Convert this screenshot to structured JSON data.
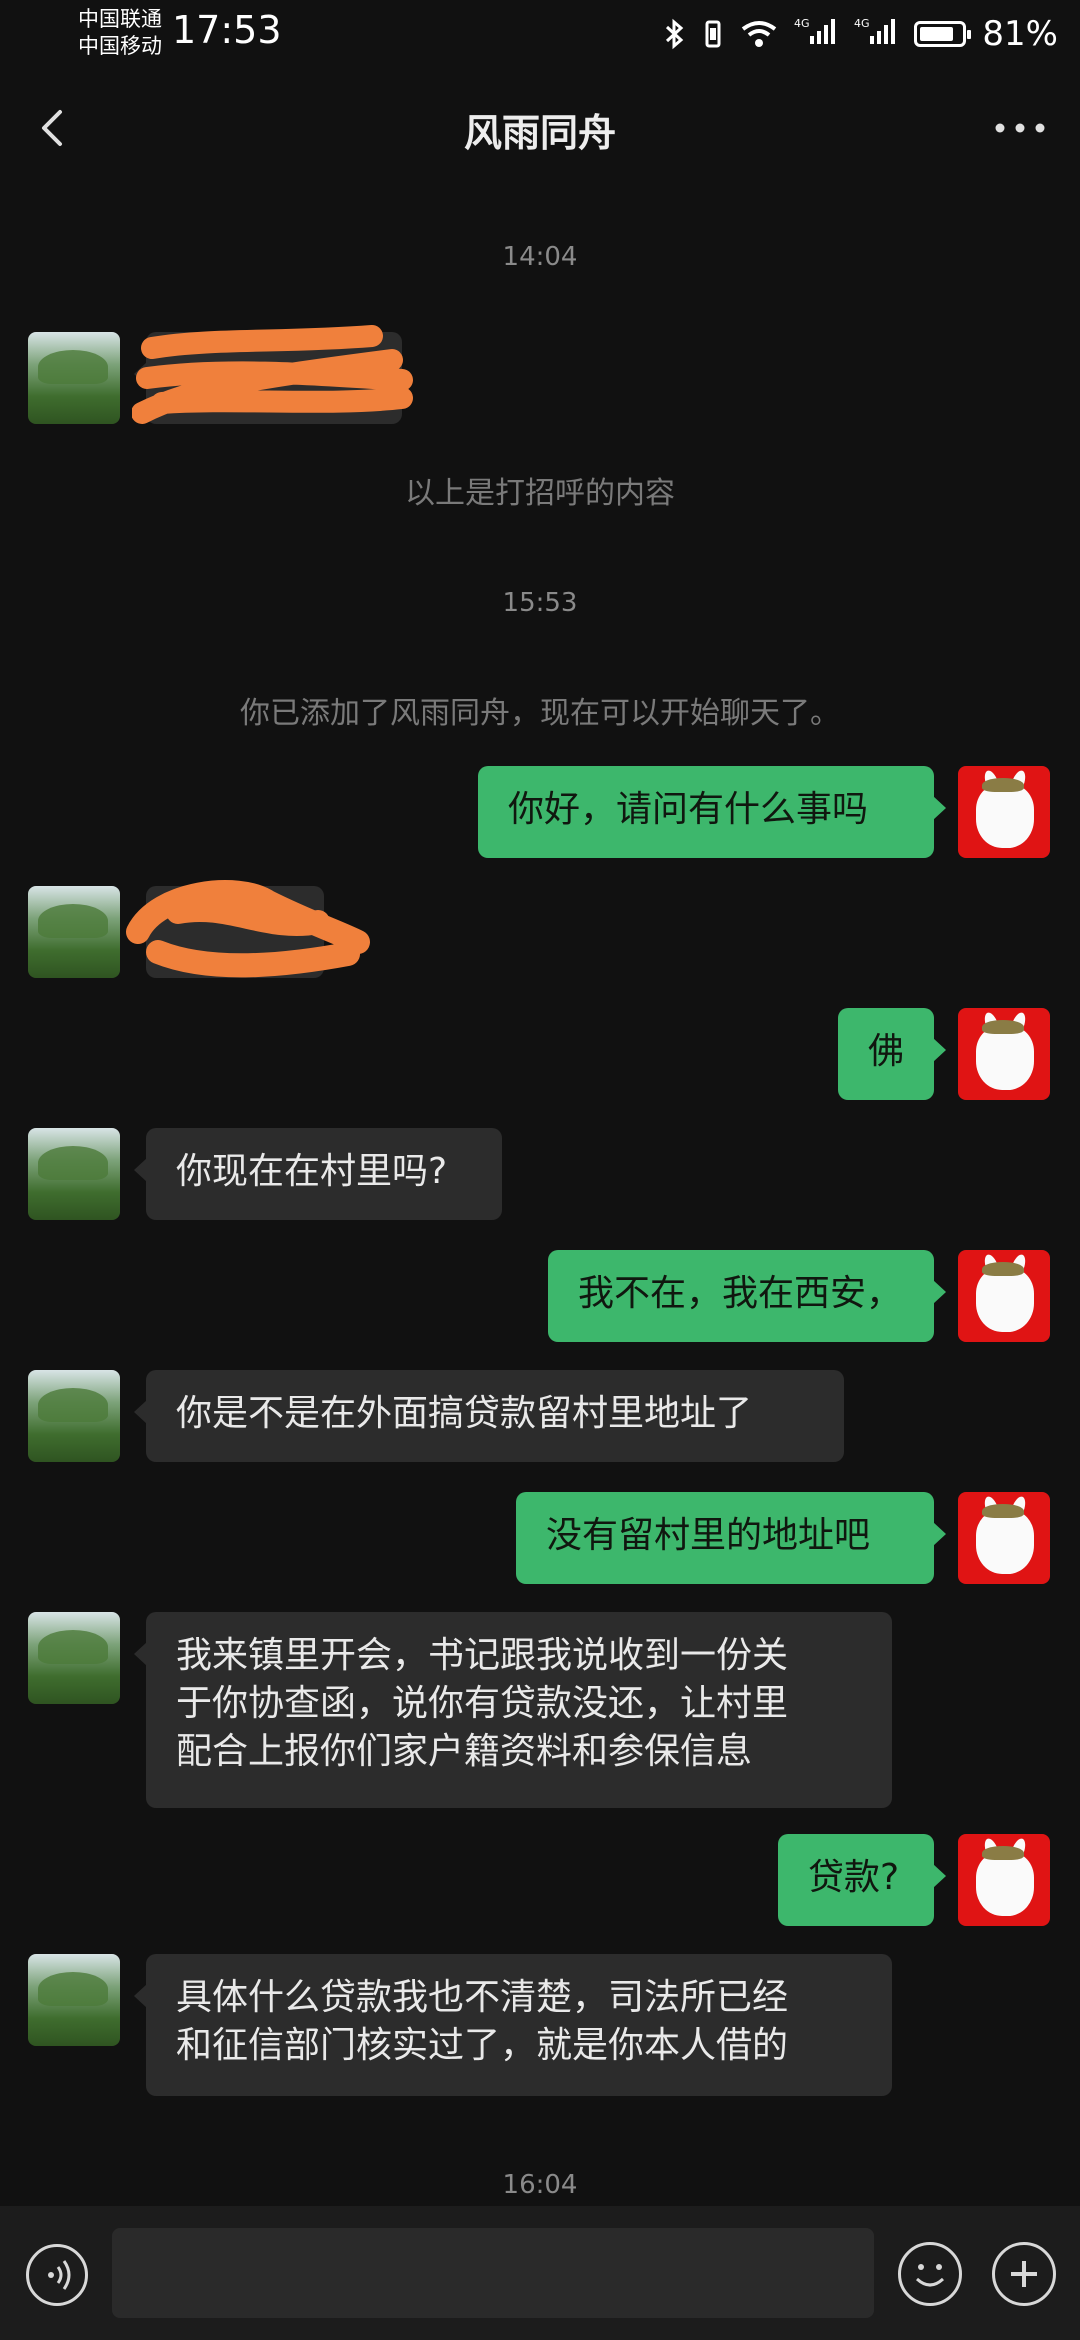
{
  "status_bar": {
    "carrier1": "中国联通",
    "carrier2": "中国移动",
    "time": "17:53",
    "network1": "4G",
    "network2": "4G",
    "battery": "81%",
    "battery_level": 0.81,
    "icons": [
      "bluetooth-icon",
      "vibrate-icon",
      "wifi-icon",
      "signal-icon",
      "signal-icon",
      "battery-icon"
    ]
  },
  "header": {
    "title": "风雨同舟",
    "back_icon": "chevron-left-icon",
    "more_icon": "more-dots-icon"
  },
  "colors": {
    "background": "#111111",
    "incoming_bubble": "#2c2c2c",
    "outgoing_bubble": "#3db76c",
    "redaction": "#f0803c",
    "avatar_right": "#e01414"
  },
  "chat": {
    "time1": "14:04",
    "greeting_note": "以上是打招呼的内容",
    "time2": "15:53",
    "added_note": "你已添加了风雨同舟，现在可以开始聊天了。",
    "time3": "16:04",
    "messages": [
      {
        "side": "left",
        "text": "",
        "redacted": true
      },
      {
        "side": "right",
        "text": "你好，请问有什么事吗"
      },
      {
        "side": "left",
        "text": "",
        "redacted": true
      },
      {
        "side": "right",
        "text": "佛"
      },
      {
        "side": "left",
        "text": "你现在在村里吗?"
      },
      {
        "side": "right",
        "text": "我不在，我在西安，"
      },
      {
        "side": "left",
        "text": "你是不是在外面搞贷款留村里地址了"
      },
      {
        "side": "right",
        "text": "没有留村里的地址吧"
      },
      {
        "side": "left",
        "text": "我来镇里开会，书记跟我说收到一份关\n于你协查函，说你有贷款没还，让村里\n配合上报你们家户籍资料和参保信息"
      },
      {
        "side": "right",
        "text": "贷款?"
      },
      {
        "side": "left",
        "text": "具体什么贷款我也不清楚，司法所已经\n和征信部门核实过了，就是你本人借的"
      }
    ]
  },
  "input_bar": {
    "voice_icon": "voice-icon",
    "emoji_icon": "emoji-icon",
    "plus_icon": "plus-icon",
    "input_value": ""
  }
}
